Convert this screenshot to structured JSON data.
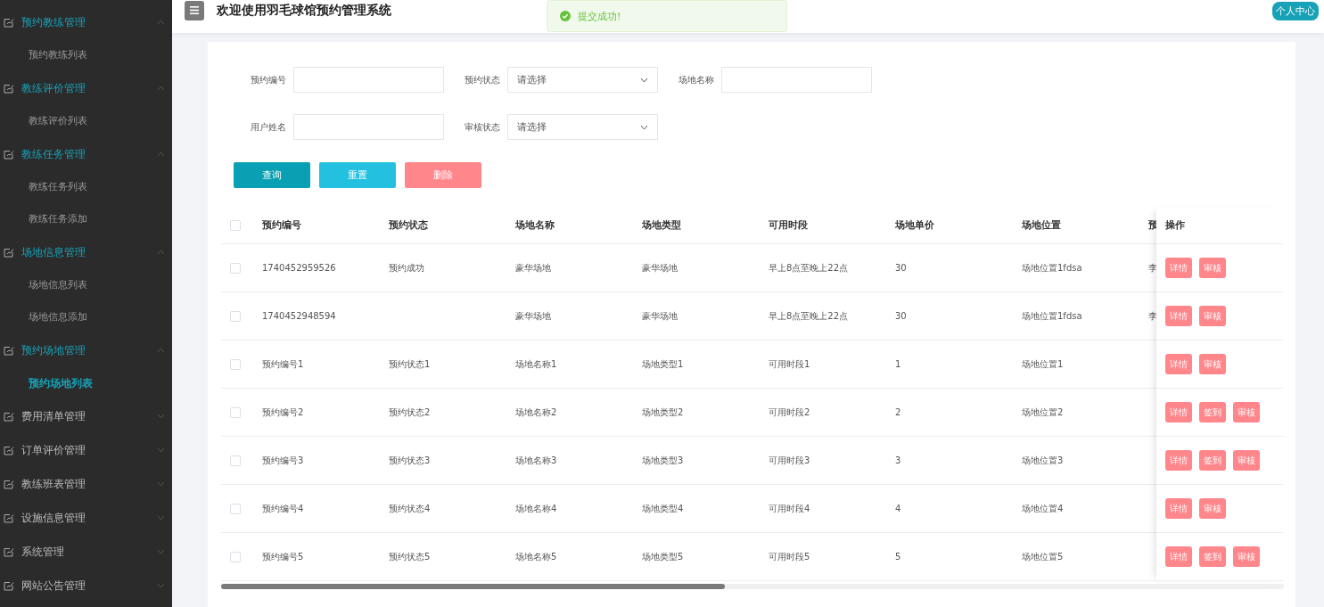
{
  "sidebar": {
    "groups": [
      {
        "label": "预约教练管理",
        "expanded": true,
        "children": [
          {
            "label": "预约教练列表",
            "selected": false
          }
        ]
      },
      {
        "label": "教练评价管理",
        "expanded": true,
        "children": [
          {
            "label": "教练评价列表",
            "selected": false
          }
        ]
      },
      {
        "label": "教练任务管理",
        "expanded": true,
        "children": [
          {
            "label": "教练任务列表",
            "selected": false
          },
          {
            "label": "教练任务添加",
            "selected": false
          }
        ]
      },
      {
        "label": "场地信息管理",
        "expanded": true,
        "children": [
          {
            "label": "场地信息列表",
            "selected": false
          },
          {
            "label": "场地信息添加",
            "selected": false
          }
        ]
      },
      {
        "label": "预约场地管理",
        "expanded": true,
        "children": [
          {
            "label": "预约场地列表",
            "selected": true
          }
        ]
      },
      {
        "label": "费用清单管理",
        "expanded": false
      },
      {
        "label": "订单评价管理",
        "expanded": false
      },
      {
        "label": "教练班表管理",
        "expanded": false
      },
      {
        "label": "设施信息管理",
        "expanded": false
      },
      {
        "label": "系统管理",
        "expanded": false
      },
      {
        "label": "网站公告管理",
        "expanded": false
      }
    ]
  },
  "header": {
    "title": "欢迎使用羽毛球馆预约管理系统",
    "toast": "提交成功!",
    "user_button": "个人中心"
  },
  "filters": [
    {
      "kind": "input",
      "label": "预约编号"
    },
    {
      "kind": "select",
      "label": "预约状态",
      "placeholder": "请选择"
    },
    {
      "kind": "input",
      "label": "场地名称"
    },
    {
      "kind": "input",
      "label": "用户姓名"
    },
    {
      "kind": "select",
      "label": "审核状态",
      "placeholder": "请选择"
    }
  ],
  "actions": [
    {
      "label": "查询",
      "kind": "primary"
    },
    {
      "label": "重置",
      "kind": "info"
    },
    {
      "label": "删除",
      "kind": "danger"
    }
  ],
  "table": {
    "columns": [
      "预约编号",
      "预约状态",
      "场地名称",
      "场地类型",
      "可用时段",
      "场地单价",
      "场地位置",
      "预"
    ],
    "action_column": "操作",
    "header_checked": false,
    "rows": [
      {
        "checked": false,
        "cells": [
          "1740452959526",
          "预约成功",
          "豪华场地",
          "豪华场地",
          "早上8点至晚上22点",
          "30",
          "场地位置1fdsa",
          "李"
        ],
        "buttons": [
          "详情",
          "审核"
        ]
      },
      {
        "checked": false,
        "cells": [
          "1740452948594",
          "",
          "豪华场地",
          "豪华场地",
          "早上8点至晚上22点",
          "30",
          "场地位置1fdsa",
          "李"
        ],
        "buttons": [
          "详情",
          "审核"
        ]
      },
      {
        "checked": false,
        "cells": [
          "预约编号1",
          "预约状态1",
          "场地名称1",
          "场地类型1",
          "可用时段1",
          "1",
          "场地位置1",
          ""
        ],
        "buttons": [
          "详情",
          "审核"
        ]
      },
      {
        "checked": false,
        "cells": [
          "预约编号2",
          "预约状态2",
          "场地名称2",
          "场地类型2",
          "可用时段2",
          "2",
          "场地位置2",
          ""
        ],
        "buttons": [
          "详情",
          "签到",
          "审核"
        ]
      },
      {
        "checked": false,
        "cells": [
          "预约编号3",
          "预约状态3",
          "场地名称3",
          "场地类型3",
          "可用时段3",
          "3",
          "场地位置3",
          ""
        ],
        "buttons": [
          "详情",
          "签到",
          "审核"
        ]
      },
      {
        "checked": false,
        "cells": [
          "预约编号4",
          "预约状态4",
          "场地名称4",
          "场地类型4",
          "可用时段4",
          "4",
          "场地位置4",
          ""
        ],
        "buttons": [
          "详情",
          "审核"
        ]
      },
      {
        "checked": false,
        "cells": [
          "预约编号5",
          "预约状态5",
          "场地名称5",
          "场地类型5",
          "可用时段5",
          "5",
          "场地位置5",
          ""
        ],
        "buttons": [
          "详情",
          "签到",
          "审核"
        ]
      }
    ]
  }
}
